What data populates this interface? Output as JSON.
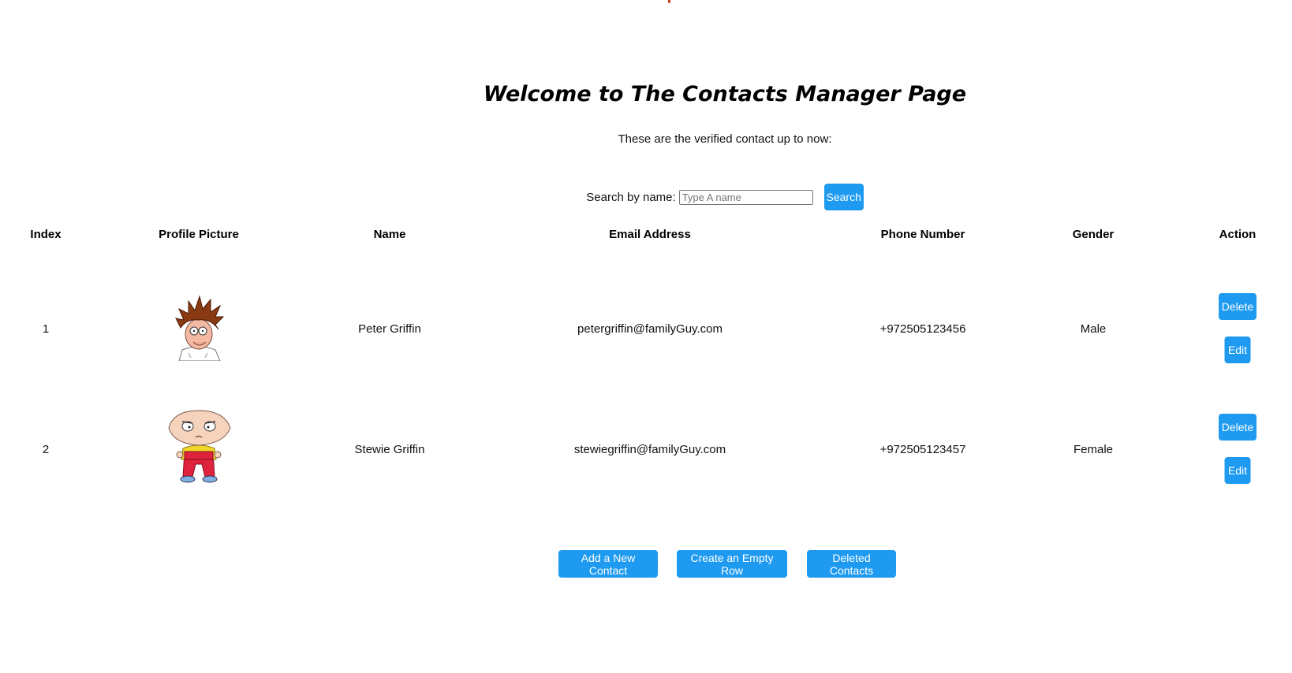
{
  "header": {
    "title": "Welcome to The Contacts Manager Page",
    "subtitle": "These are the verified contact up to now:"
  },
  "search": {
    "label": "Search by name:",
    "placeholder": "Type A name",
    "value": "",
    "button_label": "Search"
  },
  "table": {
    "columns": [
      "Index",
      "Profile Picture",
      "Name",
      "Email Address",
      "Phone Number",
      "Gender",
      "Action"
    ],
    "rows": [
      {
        "index": "1",
        "avatar": "peter-griffin-avatar",
        "name": "Peter Griffin",
        "email": "petergriffin@familyGuy.com",
        "phone": "+972505123456",
        "gender": "Male",
        "delete_label": "Delete",
        "edit_label": "Edit"
      },
      {
        "index": "2",
        "avatar": "stewie-griffin-avatar",
        "name": "Stewie Griffin",
        "email": "stewiegriffin@familyGuy.com",
        "phone": "+972505123457",
        "gender": "Female",
        "delete_label": "Delete",
        "edit_label": "Edit"
      }
    ]
  },
  "footer_actions": {
    "add_label": "Add a New Contact",
    "empty_row_label": "Create an Empty Row",
    "deleted_label": "Deleted Contacts"
  },
  "colors": {
    "button_bg": "#1e9af0",
    "button_text": "#ffffff"
  }
}
